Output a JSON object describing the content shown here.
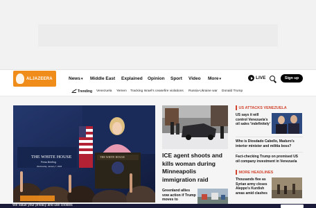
{
  "nav": {
    "logo_text": "ALJAZEERA",
    "items": [
      {
        "label": "News",
        "has_chevron": true
      },
      {
        "label": "Middle East"
      },
      {
        "label": "Explained"
      },
      {
        "label": "Opinion"
      },
      {
        "label": "Sport"
      },
      {
        "label": "Video"
      },
      {
        "label": "More",
        "has_chevron": true
      }
    ],
    "live_label": "LIVE",
    "signup_label": "Sign up"
  },
  "trending": {
    "label": "Trending",
    "items": [
      "Venezuela",
      "Yemen",
      "Tracking Israel's ceasefire violations",
      "Russia-Ukraine war",
      "Donald Trump"
    ]
  },
  "hero": {
    "podium_lines": [
      "THE WHITE HOUSE",
      "Press Briefing",
      "Wednesday, January 7, 2026"
    ],
    "lectern_text": "THE WHITE HOUSE"
  },
  "main_story": {
    "headline": "ICE agent shoots and kills woman during Minneapolis immigration raid"
  },
  "sub_story": {
    "headline": "Greenland allies vow action if Trump moves to"
  },
  "sidebar": {
    "section_title": "US ATTACKS VENEZUELA",
    "stories": [
      "US says it will control Venezuela's oil sales 'indefinitely'",
      "Who is Diosdado Cabello, Maduro's interior minister and militia boss?",
      "Fact-checking Trump on promised US oil company investment in Venezuela"
    ],
    "more_title": "MORE HEADLINES",
    "more_stories": [
      "Thousands flee as Syrian army closes Aleppo's Kurdish areas amid clashes"
    ]
  },
  "cookie": {
    "text": "We value your privacy and use cookies"
  },
  "colors": {
    "brand": "#f08c1a",
    "section_accent": "#d0442e",
    "signup_bg": "#000000"
  },
  "icons": [
    "play-icon",
    "search-icon",
    "trending-icon",
    "chevron-down-icon"
  ]
}
